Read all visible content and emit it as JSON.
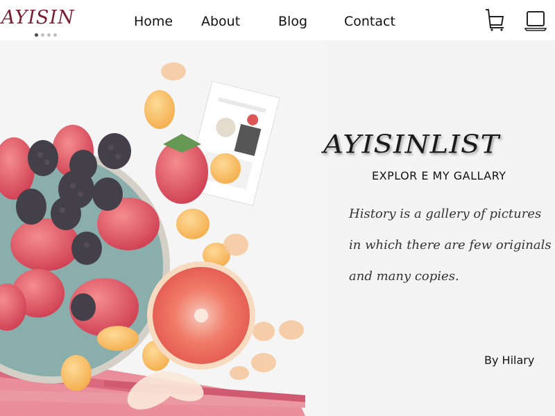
{
  "header": {
    "logo_text": "AYISIN",
    "nav": [
      {
        "label": "Home"
      },
      {
        "label": "About"
      },
      {
        "label": "Blog"
      },
      {
        "label": "Contact"
      }
    ],
    "carousel_dots": 4,
    "carousel_active_index": 0,
    "icons": [
      "cart-icon",
      "laptop-icon"
    ]
  },
  "hero": {
    "title": "AYISINLIST",
    "subtitle": "EXPLOR E MY GALLARY",
    "quote_lines": [
      "History is a gallery of pictures",
      "in which there are few originals",
      "and many copies."
    ],
    "author": "By Hilary",
    "background_image": "fruit-flatlay-image"
  },
  "colors": {
    "logo": "#7a1f33",
    "text": "#111111",
    "hero_bg": "#f4f4f4"
  }
}
